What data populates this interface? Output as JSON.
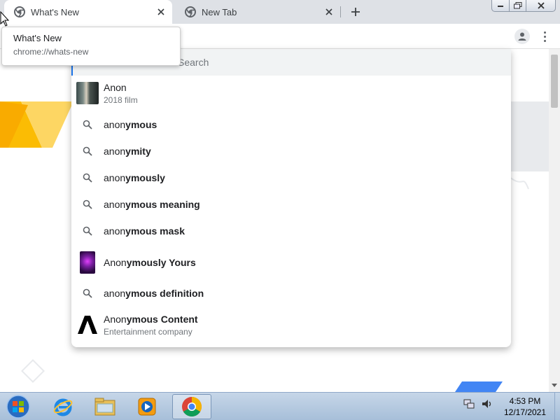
{
  "browser": {
    "tabs": [
      {
        "title": "What's New",
        "icon": "chrome-icon",
        "active": true
      },
      {
        "title": "New Tab",
        "icon": "chrome-icon",
        "active": false
      }
    ],
    "new_tab_icon": "plus-icon",
    "window_controls": [
      "minimize-icon",
      "restore-icon",
      "close-icon"
    ]
  },
  "tooltip": {
    "title": "What's New",
    "url": "chrome://whats-new"
  },
  "omnibox": {
    "placeholder": "Search",
    "suggestions": [
      {
        "prefix": "Anon",
        "bold": "",
        "subtitle": "2018 film",
        "icon": "movie-thumbnail"
      },
      {
        "prefix": "anon",
        "bold": "ymous",
        "subtitle": "",
        "icon": "search-icon"
      },
      {
        "prefix": "anon",
        "bold": "ymity",
        "subtitle": "",
        "icon": "search-icon"
      },
      {
        "prefix": "anon",
        "bold": "ymously",
        "subtitle": "",
        "icon": "search-icon"
      },
      {
        "prefix": "anon",
        "bold": "ymous meaning",
        "subtitle": "",
        "icon": "search-icon"
      },
      {
        "prefix": "anon",
        "bold": "ymous mask",
        "subtitle": "",
        "icon": "search-icon"
      },
      {
        "prefix": "Anon",
        "bold": "ymously Yours",
        "subtitle": "",
        "icon": "movie-thumbnail"
      },
      {
        "prefix": "anon",
        "bold": "ymous definition",
        "subtitle": "",
        "icon": "search-icon"
      },
      {
        "prefix": "Anon",
        "bold": "ymous Content",
        "subtitle": "Entertainment company",
        "icon": "company-logo"
      }
    ]
  },
  "taskbar": {
    "items": [
      "start-button",
      "internet-explorer-icon",
      "file-explorer-icon",
      "media-player-icon",
      "chrome-icon"
    ],
    "clock_time": "4:53 PM",
    "clock_date": "12/17/2021"
  },
  "colors": {
    "tabstrip": "#dee1e6",
    "accent": "#1a73e8",
    "banner_yellow": "#fbbc04",
    "banner_blue": "#4285f4"
  }
}
